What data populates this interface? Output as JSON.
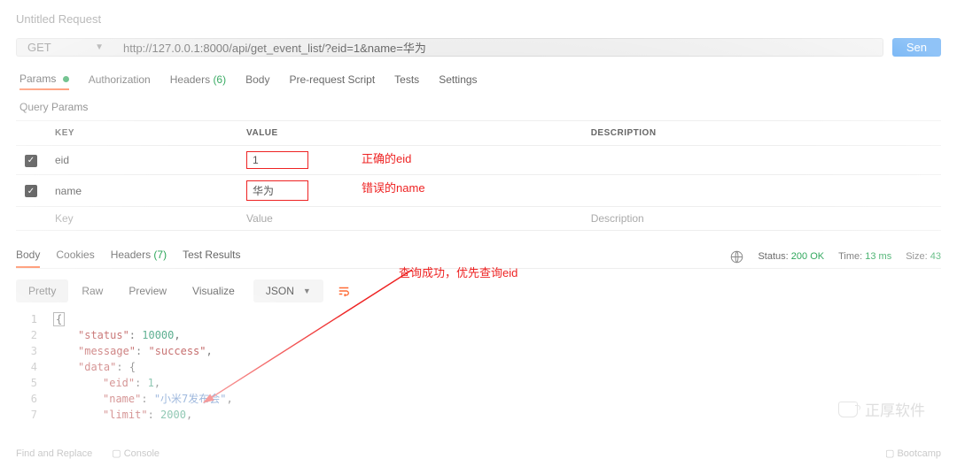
{
  "title": "Untitled Request",
  "request": {
    "method": "GET",
    "url": "http://127.0.0.1:8000/api/get_event_list/?eid=1&name=华为",
    "send": "Sen"
  },
  "tabs": {
    "params": "Params",
    "auth": "Authorization",
    "headers": "Headers",
    "headers_count": "(6)",
    "body": "Body",
    "prescript": "Pre-request Script",
    "tests": "Tests",
    "settings": "Settings"
  },
  "query": {
    "title": "Query Params",
    "cols": {
      "key": "KEY",
      "value": "VALUE",
      "desc": "DESCRIPTION"
    },
    "rows": [
      {
        "key": "eid",
        "value": "1",
        "note": "正确的eid"
      },
      {
        "key": "name",
        "value": "华为",
        "note": "错误的name"
      }
    ],
    "placeholder": {
      "key": "Key",
      "value": "Value",
      "desc": "Description"
    },
    "summary": "查询成功，优先查询eid"
  },
  "resp": {
    "tabs": {
      "body": "Body",
      "cookies": "Cookies",
      "headers": "Headers",
      "headers_count": "(7)",
      "tests": "Test Results"
    },
    "status_label": "Status:",
    "status_value": "200 OK",
    "time_label": "Time:",
    "time_value": "13 ms",
    "size_label": "Size:",
    "size_value": "43"
  },
  "fmt": {
    "pretty": "Pretty",
    "raw": "Raw",
    "preview": "Preview",
    "visualize": "Visualize",
    "type": "JSON"
  },
  "json": {
    "l1": "{",
    "l2": {
      "k": "\"status\"",
      "v": "10000",
      "tail": ","
    },
    "l3": {
      "k": "\"message\"",
      "v": "\"success\"",
      "tail": ","
    },
    "l4": {
      "k": "\"data\"",
      "v": "{"
    },
    "l5": {
      "k": "\"eid\"",
      "v": "1",
      "tail": ","
    },
    "l6": {
      "k": "\"name\"",
      "v": "\"小米7发布会\"",
      "tail": ","
    },
    "l7": {
      "k": "\"limit\"",
      "v": "2000",
      "tail": ","
    }
  },
  "bottom": {
    "find": "Find and Replace",
    "console": "Console",
    "boot": "Bootcamp"
  },
  "watermark": "正厚软件"
}
